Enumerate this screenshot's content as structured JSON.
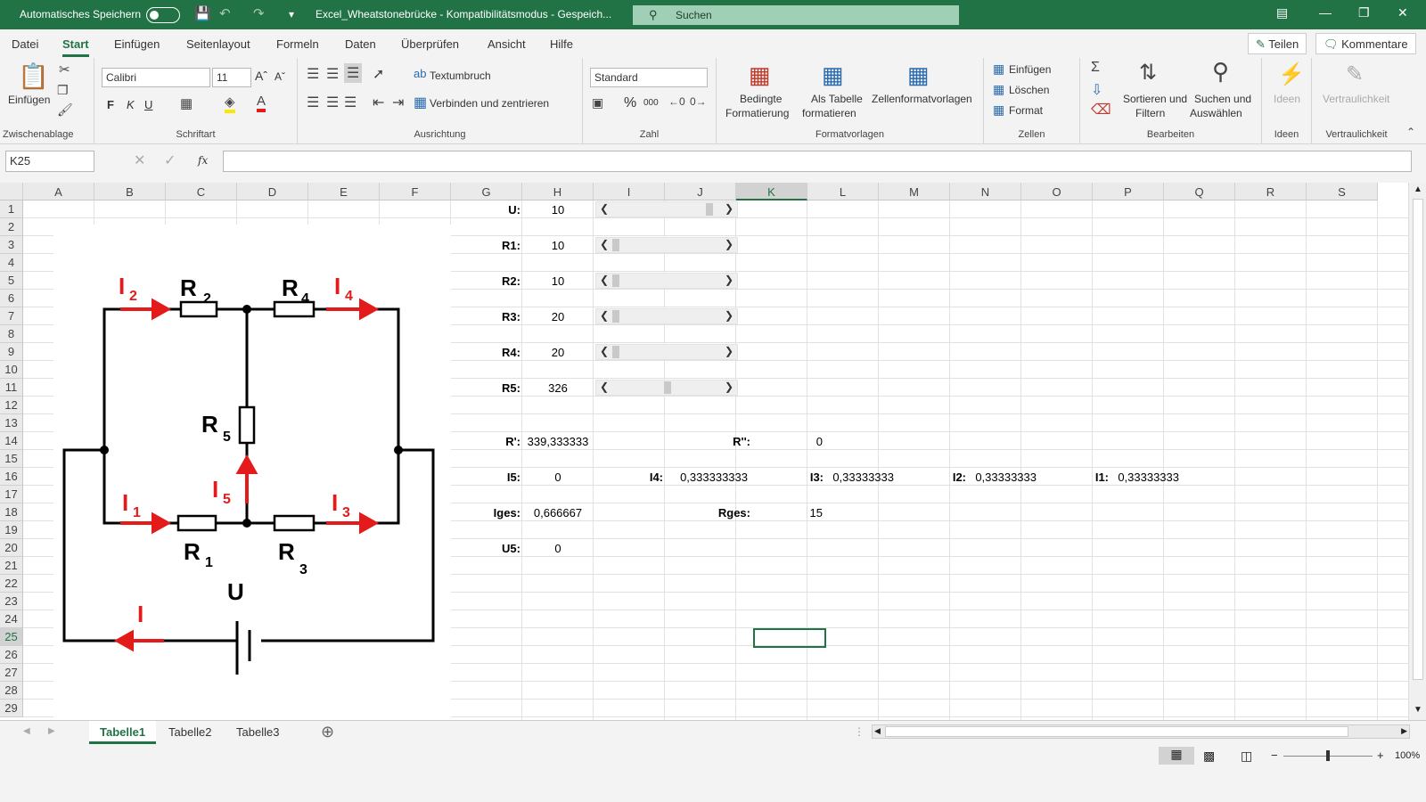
{
  "titlebar": {
    "autosave": "Automatisches Speichern",
    "doc": "Excel_Wheatstonebrücke - Kompatibilitätsmodus - Gespeich...",
    "search": "Suchen"
  },
  "menu": {
    "tabs": [
      "Datei",
      "Start",
      "Einfügen",
      "Seitenlayout",
      "Formeln",
      "Daten",
      "Überprüfen",
      "Ansicht",
      "Hilfe"
    ],
    "share": "Teilen",
    "comments": "Kommentare"
  },
  "ribbon": {
    "clipboard": {
      "paste": "Einfügen",
      "label": "Zwischenablage"
    },
    "font": {
      "name": "Calibri",
      "size": "11",
      "bold": "F",
      "italic": "K",
      "underline": "U",
      "label": "Schriftart"
    },
    "align": {
      "wrap": "Textumbruch",
      "merge": "Verbinden und zentrieren",
      "label": "Ausrichtung"
    },
    "number": {
      "format": "Standard",
      "percent": "%",
      "thousands": "000",
      "label": "Zahl"
    },
    "styles": {
      "cond1": "Bedingte",
      "cond2": "Formatierung",
      "table1": "Als Tabelle",
      "table2": "formatieren",
      "cell": "Zellenformatvorlagen",
      "label": "Formatvorlagen"
    },
    "cells": {
      "insert": "Einfügen",
      "delete": "Löschen",
      "format": "Format",
      "label": "Zellen"
    },
    "edit": {
      "sort1": "Sortieren und",
      "sort2": "Filtern",
      "find1": "Suchen und",
      "find2": "Auswählen",
      "label": "Bearbeiten"
    },
    "ideas": {
      "btn": "Ideen",
      "label": "Ideen"
    },
    "sens": {
      "btn": "Vertraulichkeit",
      "label": "Vertraulichkeit"
    }
  },
  "namebox": "K25",
  "fx": "fx",
  "columns": [
    "A",
    "B",
    "C",
    "D",
    "E",
    "F",
    "G",
    "H",
    "I",
    "J",
    "K",
    "L",
    "M",
    "N",
    "O",
    "P",
    "Q",
    "R",
    "S"
  ],
  "rows": [
    "1",
    "2",
    "3",
    "4",
    "5",
    "6",
    "7",
    "8",
    "9",
    "10",
    "11",
    "12",
    "13",
    "14",
    "15",
    "16",
    "17",
    "18",
    "19",
    "20",
    "21",
    "22",
    "23",
    "24",
    "25",
    "26",
    "27",
    "28",
    "29"
  ],
  "cells": {
    "u_l": "U:",
    "u_v": "10",
    "r1_l": "R1:",
    "r1_v": "10",
    "r2_l": "R2:",
    "r2_v": "10",
    "r3_l": "R3:",
    "r3_v": "20",
    "r4_l": "R4:",
    "r4_v": "20",
    "r5_l": "R5:",
    "r5_v": "326",
    "rp_l": "R':",
    "rp_v": "339,333333",
    "rpp_l": "R'':",
    "rpp_v": "0",
    "i5_l": "I5:",
    "i5_v": "0",
    "i4_l": "I4:",
    "i4_v": "0,333333333",
    "i3_l": "I3:",
    "i3_v": "0,33333333",
    "i2_l": "I2:",
    "i2_v": "0,33333333",
    "i1_l": "I1:",
    "i1_v": "0,33333333",
    "iges_l": "Iges:",
    "iges_v": "0,666667",
    "rges_l": "Rges:",
    "rges_v": "15",
    "u5_l": "U5:",
    "u5_v": "0"
  },
  "scrollbar_levels": [
    0.88,
    0.03,
    0.03,
    0.03,
    0.03,
    0.5
  ],
  "circuit": {
    "R2": "R",
    "R2s": "2",
    "R4": "R",
    "R4s": "4",
    "R5": "R",
    "R5s": "5",
    "R1": "R",
    "R1s": "1",
    "R3": "R",
    "R3s": "3",
    "I2": "I",
    "I2s": "2",
    "I4": "I",
    "I4s": "4",
    "I5": "I",
    "I5s": "5",
    "I1": "I",
    "I1s": "1",
    "I3": "I",
    "I3s": "3",
    "U": "U",
    "I": "I"
  },
  "sheets": [
    "Tabelle1",
    "Tabelle2",
    "Tabelle3"
  ],
  "zoom": "100%",
  "colors": {
    "excel_green": "#217346",
    "arrow_red": "#e31b1b"
  }
}
